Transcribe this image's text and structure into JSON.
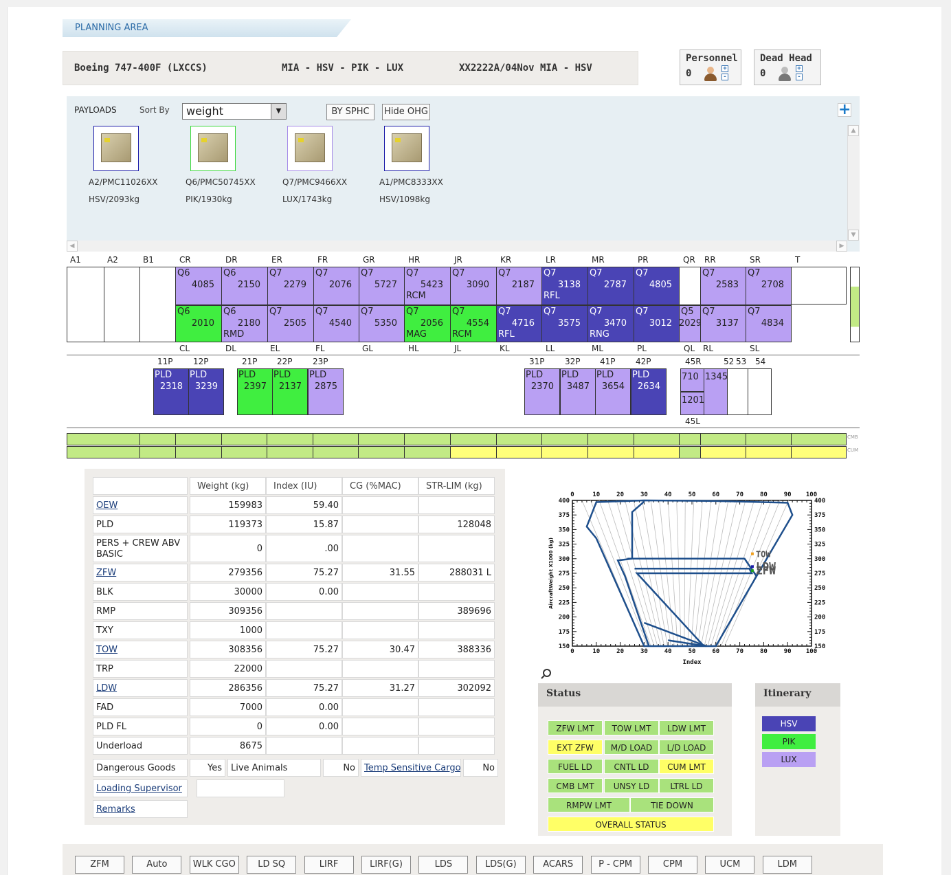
{
  "header": {
    "title": "PLANNING AREA"
  },
  "flight": {
    "aircraft": "Boeing 747-400F (LXCCS)",
    "route": "MIA - HSV - PIK - LUX",
    "flight_no": "XX2222A/04Nov MIA - HSV"
  },
  "crew": {
    "personnel_label": "Personnel",
    "personnel_count": "0",
    "deadhead_label": "Dead Head",
    "deadhead_count": "0"
  },
  "payloads": {
    "label": "PAYLOADS",
    "sort_label": "Sort By",
    "sort_value": "weight",
    "by_sphc": "BY SPHC",
    "hide_ohg": "Hide OHG",
    "items": [
      {
        "name": "A2/PMC11026XX",
        "dest": "HSV/2093kg",
        "border": "#1a1aa8"
      },
      {
        "name": "Q6/PMC50745XX",
        "dest": "PIK/1930kg",
        "border": "#3ad83a"
      },
      {
        "name": "Q7/PMC9466XX",
        "dest": "LUX/1743kg",
        "border": "#a58ae8"
      },
      {
        "name": "A1/PMC8333XX",
        "dest": "HSV/1098kg",
        "border": "#1a1aa8"
      }
    ]
  },
  "main_deck": {
    "top_labels": [
      "A1",
      "A2",
      "B1",
      "CR",
      "DR",
      "ER",
      "FR",
      "GR",
      "HR",
      "JR",
      "KR",
      "LR",
      "MR",
      "PR",
      "QR",
      "RR",
      "SR",
      "T"
    ],
    "bottom_labels": [
      "CL",
      "DL",
      "EL",
      "FL",
      "GL",
      "HL",
      "JL",
      "KL",
      "LL",
      "ML",
      "PL",
      "QL",
      "RL",
      "SL"
    ],
    "right_row": [
      {
        "c": "empty",
        "l1": "",
        "l2": "",
        "l3": ""
      },
      {
        "c": "empty",
        "l1": "",
        "l2": "",
        "l3": ""
      },
      {
        "c": "empty",
        "l1": "",
        "l2": "",
        "l3": ""
      },
      {
        "c": "lux",
        "l1": "Q6",
        "l2": "4085",
        "l3": ""
      },
      {
        "c": "lux",
        "l1": "Q6",
        "l2": "2150",
        "l3": ""
      },
      {
        "c": "lux",
        "l1": "Q7",
        "l2": "2279",
        "l3": ""
      },
      {
        "c": "lux",
        "l1": "Q7",
        "l2": "2076",
        "l3": ""
      },
      {
        "c": "lux",
        "l1": "Q7",
        "l2": "5727",
        "l3": ""
      },
      {
        "c": "lux",
        "l1": "Q7",
        "l2": "5423",
        "l3": "RCM"
      },
      {
        "c": "lux",
        "l1": "Q7",
        "l2": "3090",
        "l3": ""
      },
      {
        "c": "lux",
        "l1": "Q7",
        "l2": "2187",
        "l3": ""
      },
      {
        "c": "hsv",
        "l1": "Q7",
        "l2": "3138",
        "l3": "RFL"
      },
      {
        "c": "hsv",
        "l1": "Q7",
        "l2": "2787",
        "l3": ""
      },
      {
        "c": "hsv",
        "l1": "Q7",
        "l2": "4805",
        "l3": ""
      },
      {
        "c": "empty",
        "l1": "",
        "l2": "",
        "l3": ""
      },
      {
        "c": "lux",
        "l1": "Q7",
        "l2": "2583",
        "l3": ""
      },
      {
        "c": "lux",
        "l1": "Q7",
        "l2": "2708",
        "l3": ""
      },
      {
        "c": "empty",
        "l1": "",
        "l2": "",
        "l3": ""
      }
    ],
    "left_row": [
      {
        "c": "pik",
        "l1": "Q6",
        "l2": "2010",
        "l3": ""
      },
      {
        "c": "lux",
        "l1": "Q6",
        "l2": "2180",
        "l3": "RMD"
      },
      {
        "c": "lux",
        "l1": "Q7",
        "l2": "2505",
        "l3": ""
      },
      {
        "c": "lux",
        "l1": "Q7",
        "l2": "4540",
        "l3": ""
      },
      {
        "c": "lux",
        "l1": "Q7",
        "l2": "5350",
        "l3": ""
      },
      {
        "c": "pik",
        "l1": "Q7",
        "l2": "2056",
        "l3": "MAG"
      },
      {
        "c": "pik",
        "l1": "Q7",
        "l2": "4554",
        "l3": "RCM"
      },
      {
        "c": "hsv",
        "l1": "Q7",
        "l2": "4716",
        "l3": "RFL"
      },
      {
        "c": "hsv",
        "l1": "Q7",
        "l2": "3575",
        "l3": ""
      },
      {
        "c": "hsv",
        "l1": "Q7",
        "l2": "3470",
        "l3": "RNG"
      },
      {
        "c": "hsv",
        "l1": "Q7",
        "l2": "3012",
        "l3": ""
      },
      {
        "c": "lux",
        "l1": "Q5",
        "l2": "2029",
        "l3": ""
      },
      {
        "c": "lux",
        "l1": "Q7",
        "l2": "3137",
        "l3": ""
      },
      {
        "c": "lux",
        "l1": "Q7",
        "l2": "4834",
        "l3": ""
      }
    ]
  },
  "lower_deck": {
    "fwd_labels": [
      "11P",
      "12P",
      "21P",
      "22P",
      "23P"
    ],
    "fwd": [
      {
        "c": "hsv",
        "l1": "PLD",
        "l2": "2318"
      },
      {
        "c": "hsv",
        "l1": "PLD",
        "l2": "3239"
      },
      {
        "c": "pik",
        "l1": "PLD",
        "l2": "2397"
      },
      {
        "c": "pik",
        "l1": "PLD",
        "l2": "2137"
      },
      {
        "c": "lux",
        "l1": "PLD",
        "l2": "2875"
      }
    ],
    "aft_labels": [
      "31P",
      "32P",
      "41P",
      "42P"
    ],
    "aft": [
      {
        "c": "lux",
        "l1": "PLD",
        "l2": "2370"
      },
      {
        "c": "lux",
        "l1": "PLD",
        "l2": "3487"
      },
      {
        "c": "lux",
        "l1": "PLD",
        "l2": "3654"
      },
      {
        "c": "hsv",
        "l1": "PLD",
        "l2": "2634"
      }
    ],
    "bulk_labels": [
      "45R",
      "52",
      "53",
      "54"
    ],
    "bulk_45r": "710",
    "bulk_45l": "1201",
    "bulk_52": "1345",
    "bulk_45l_label": "45L"
  },
  "summary_bars": {
    "cmb": "CMB",
    "cum": "CUM"
  },
  "weights": {
    "headers": [
      "Weight (kg)",
      "Index (IU)",
      "CG (%MAC)",
      "STR-LIM (kg)"
    ],
    "rows": [
      {
        "label": "OEW",
        "link": true,
        "w": "159983",
        "i": "59.40",
        "cg": "",
        "lim": ""
      },
      {
        "label": "PLD",
        "link": false,
        "w": "119373",
        "i": "15.87",
        "cg": "",
        "lim": "128048"
      },
      {
        "label": "PERS + CREW ABV BASIC",
        "link": false,
        "w": "0",
        "i": ".00",
        "cg": "",
        "lim": ""
      },
      {
        "label": "ZFW",
        "link": true,
        "w": "279356",
        "i": "75.27",
        "cg": "31.55",
        "lim": "288031 L"
      },
      {
        "label": "BLK",
        "link": false,
        "w": "30000",
        "i": "0.00",
        "cg": "",
        "lim": ""
      },
      {
        "label": "RMP",
        "link": false,
        "w": "309356",
        "i": "",
        "cg": "",
        "lim": "389696"
      },
      {
        "label": "TXY",
        "link": false,
        "w": "1000",
        "i": "",
        "cg": "",
        "lim": ""
      },
      {
        "label": "TOW",
        "link": true,
        "w": "308356",
        "i": "75.27",
        "cg": "30.47",
        "lim": "388336"
      },
      {
        "label": "TRP",
        "link": false,
        "w": "22000",
        "i": "",
        "cg": "",
        "lim": ""
      },
      {
        "label": "LDW",
        "link": true,
        "w": "286356",
        "i": "75.27",
        "cg": "31.27",
        "lim": "302092"
      },
      {
        "label": "FAD",
        "link": false,
        "w": "7000",
        "i": "0.00",
        "cg": "",
        "lim": ""
      },
      {
        "label": "PLD FL",
        "link": false,
        "w": "0",
        "i": "0.00",
        "cg": "",
        "lim": ""
      },
      {
        "label": "Underload",
        "link": false,
        "w": "8675",
        "i": "",
        "cg": "",
        "lim": ""
      }
    ],
    "dg_label": "Dangerous Goods",
    "dg_value": "Yes",
    "avi_label": "Live Animals",
    "avi_value": "No",
    "temp_label": "Temp Sensitive Cargo",
    "temp_value": "No",
    "supervisor_label": "Loading Supervisor",
    "remarks_label": "Remarks"
  },
  "chart_data": {
    "type": "line",
    "xlabel": "Index",
    "ylabel": "AircraftWeight X1000 (kg)",
    "xlim": [
      0,
      100
    ],
    "ylim": [
      150,
      400
    ],
    "x_ticks": [
      "0",
      "10",
      "20",
      "30",
      "40",
      "50",
      "60",
      "70",
      "80",
      "90",
      "100"
    ],
    "y_ticks": [
      "400",
      "375",
      "350",
      "325",
      "300",
      "275",
      "250",
      "225",
      "200",
      "175",
      "150"
    ],
    "series": [
      {
        "name": "envelope",
        "points": [
          [
            10,
            397
          ],
          [
            30,
            400
          ],
          [
            60,
            399
          ],
          [
            90,
            396
          ],
          [
            92,
            375
          ],
          [
            77,
            270
          ],
          [
            60,
            150
          ],
          [
            30,
            150
          ],
          [
            10,
            335
          ],
          [
            6,
            355
          ]
        ]
      },
      {
        "name": "inner",
        "points": [
          [
            30,
            398
          ],
          [
            25,
            380
          ],
          [
            25,
            300
          ],
          [
            19,
            297
          ],
          [
            22,
            270
          ],
          [
            32,
            150
          ]
        ]
      },
      {
        "name": "inner2",
        "points": [
          [
            23,
            300
          ],
          [
            72,
            300
          ],
          [
            77,
            270
          ]
        ]
      },
      {
        "name": "inner3",
        "points": [
          [
            26,
            283
          ],
          [
            74,
            283
          ],
          [
            75,
            275
          ],
          [
            27,
            275
          ],
          [
            55,
            150
          ]
        ]
      },
      {
        "name": "inner4",
        "points": [
          [
            30,
            190
          ],
          [
            56,
            150
          ],
          [
            40,
            160
          ]
        ]
      }
    ],
    "markers": [
      {
        "name": "TOW",
        "x": 75.27,
        "y": 308.4,
        "color": "#f0a020"
      },
      {
        "name": "LDW",
        "x": 75.27,
        "y": 286.4,
        "color": "#1a1aa8"
      },
      {
        "name": "ZFW",
        "x": 75.27,
        "y": 279.4,
        "color": "#20a020"
      }
    ]
  },
  "status": {
    "title": "Status",
    "items": [
      {
        "label": "ZFW LMT",
        "c": "g"
      },
      {
        "label": "TOW LMT",
        "c": "g"
      },
      {
        "label": "LDW LMT",
        "c": "g"
      },
      {
        "label": "EXT ZFW",
        "c": "yl"
      },
      {
        "label": "M/D LOAD",
        "c": "g"
      },
      {
        "label": "L/D LOAD",
        "c": "g"
      },
      {
        "label": "FUEL LD",
        "c": "g"
      },
      {
        "label": "CNTL LD",
        "c": "g"
      },
      {
        "label": "CUM LMT",
        "c": "yl"
      },
      {
        "label": "CMB LMT",
        "c": "g"
      },
      {
        "label": "UNSY LD",
        "c": "g"
      },
      {
        "label": "LTRL LD",
        "c": "g"
      },
      {
        "label": "RMPW LMT",
        "c": "g"
      },
      {
        "label": "TIE DOWN",
        "c": "g"
      },
      {
        "label": "OVERALL STATUS",
        "c": "yl"
      }
    ]
  },
  "itinerary": {
    "title": "Itinerary",
    "items": [
      {
        "label": "HSV",
        "color": "#4a44b5",
        "text": "#ffffff"
      },
      {
        "label": "PIK",
        "color": "#40ee40",
        "text": "#222222"
      },
      {
        "label": "LUX",
        "color": "#b9a0f3",
        "text": "#222222"
      }
    ]
  },
  "bottom_buttons": [
    "ZFM",
    "Auto",
    "WLK CGO",
    "LD SQ",
    "LIRF",
    "LIRF(G)",
    "LDS",
    "LDS(G)",
    "ACARS",
    "P - CPM",
    "CPM",
    "UCM",
    "LDM"
  ]
}
